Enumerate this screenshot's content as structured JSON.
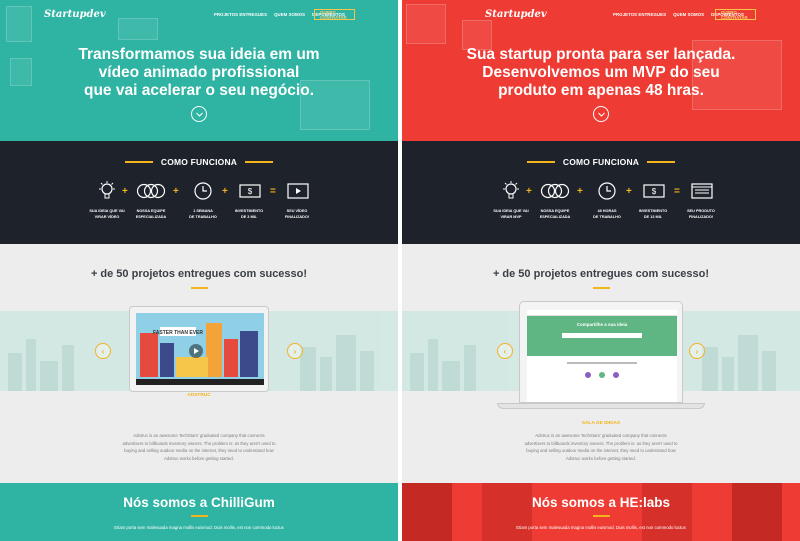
{
  "left": {
    "logo": "Startupdev",
    "nav": {
      "items": [
        "PROJETOS ENTREGUES",
        "QUEM SOMOS",
        "DEPOIMENTOS"
      ],
      "cta": "QUERO CONTRATAR"
    },
    "headline": [
      "Transformamos sua ideia em um",
      "vídeo animado profissional",
      "que vai acelerar o seu negócio."
    ],
    "how": {
      "title": "COMO FUNCIONA",
      "steps": [
        {
          "icon": "lightbulb-icon",
          "label": [
            "SUA IDEIA QUE VAI",
            "VIRAR VÍDEO"
          ]
        },
        {
          "icon": "team-icon",
          "label": [
            "NOSSA EQUIPE",
            "ESPECIALIZADA"
          ]
        },
        {
          "icon": "clock-icon",
          "label": [
            "1 SEMANA",
            "DE TRABALHO"
          ]
        },
        {
          "icon": "money-icon",
          "label": [
            "INVESTIMENTO",
            "DE 3 MIL"
          ]
        },
        {
          "icon": "video-icon",
          "label": [
            "SEU VÍDEO",
            "FINALIZADO!"
          ]
        }
      ]
    },
    "projects": {
      "title": "+ de 50 projetos entregues com sucesso!",
      "name": "ADSTRUC",
      "video_sign": "FASTER THAN EVER",
      "description": [
        "Adstruc is an awesome TechStars' graduated company that connects",
        "advertisers to billboards inventory owners. The problem is: as they aren't used to",
        "buying and selling outdoor media on the internet, they need to understand how",
        "Adstruc works before getting started."
      ]
    },
    "team": {
      "title": "Nós somos a ChilliGum",
      "description": "Etiam porta sem malesuada magna mollis euismod. Duis mollis, est non commodo luctus"
    },
    "colors": {
      "accent": "#2fb3a3"
    }
  },
  "right": {
    "logo": "Startupdev",
    "nav": {
      "items": [
        "PROJETOS ENTREGUES",
        "QUEM SOMOS",
        "DEPOIMENTOS"
      ],
      "cta": "QUERO CONTRATAR"
    },
    "headline": [
      "Sua startup pronta para ser lançada.",
      "Desenvolvemos um MVP do seu",
      "produto em apenas 48 hras."
    ],
    "how": {
      "title": "COMO FUNCIONA",
      "steps": [
        {
          "icon": "lightbulb-icon",
          "label": [
            "SUA IDEIA QUE VAI",
            "VIRAR MVP"
          ]
        },
        {
          "icon": "team-icon",
          "label": [
            "NOSSA EQUIPE",
            "ESPECIALIZADA"
          ]
        },
        {
          "icon": "clock-icon",
          "label": [
            "48 HORAS",
            "DE TRABALHO"
          ]
        },
        {
          "icon": "money-icon",
          "label": [
            "INVESTIMENTO",
            "DE 12 MIL"
          ]
        },
        {
          "icon": "browser-icon",
          "label": [
            "SEU PRODUTO",
            "FINALIZADO!"
          ]
        }
      ]
    },
    "projects": {
      "title": "+ de 50 projetos entregues com sucesso!",
      "name": "SALA DE IDEIAS",
      "screen_heading": "Compartilhe a sua ideia",
      "description": [
        "Adstruc is an awesome TechStars' graduated company that connects",
        "advertisers to billboards inventory owners. The problem is: as they aren't used to",
        "buying and selling outdoor media on the internet, they need to understand how",
        "Adstruc works before getting started."
      ]
    },
    "team": {
      "title": "Nós somos a HE:labs",
      "description": "Etiam porta sem malesuada magna mollis euismod. Duis mollis, est non commodo luctus"
    },
    "colors": {
      "accent": "#ee3b33"
    }
  }
}
